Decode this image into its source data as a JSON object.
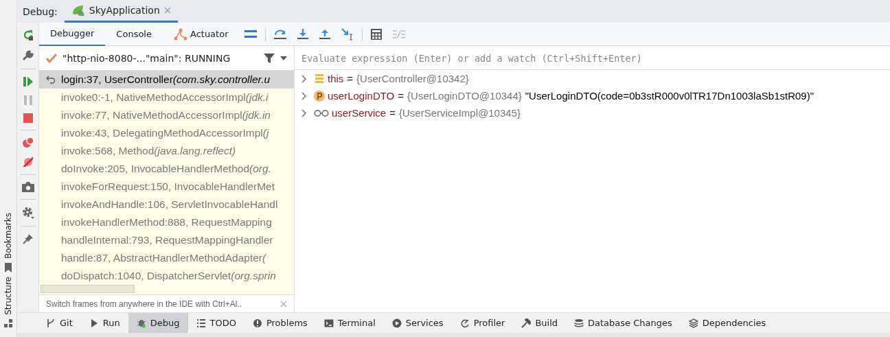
{
  "header": {
    "label": "Debug:",
    "tab": {
      "title": "SkyApplication",
      "selected": true
    }
  },
  "side_labels": [
    "Bookmarks",
    "Structure"
  ],
  "tabs": [
    {
      "label": "Debugger",
      "selected": true
    },
    {
      "label": "Console",
      "selected": false
    },
    {
      "label": "Actuator",
      "selected": false
    }
  ],
  "thread": {
    "text": "\"http-nio-8080-...\"main\": RUNNING"
  },
  "frames": [
    {
      "method": "login:37, UserController",
      "package": "(com.sky.controller.u",
      "kind": "user",
      "selected": true
    },
    {
      "method": "invoke0:-1, NativeMethodAccessorImpl",
      "package": "(jdk.i",
      "kind": "library",
      "selected": false
    },
    {
      "method": "invoke:77, NativeMethodAccessorImpl",
      "package": "(jdk.in",
      "kind": "library",
      "selected": false
    },
    {
      "method": "invoke:43, DelegatingMethodAccessorImpl",
      "package": "(j",
      "kind": "library",
      "selected": false
    },
    {
      "method": "invoke:568, Method",
      "package": "(java.lang.reflect)",
      "kind": "library",
      "selected": false
    },
    {
      "method": "doInvoke:205, InvocableHandlerMethod",
      "package": "(org.",
      "kind": "library",
      "selected": false
    },
    {
      "method": "invokeForRequest:150, InvocableHandlerMet",
      "kind": "library",
      "selected": false
    },
    {
      "method": "invokeAndHandle:106, ServletInvocableHandl",
      "kind": "library",
      "selected": false
    },
    {
      "method": "invokeHandlerMethod:888, RequestMapping",
      "kind": "library",
      "selected": false
    },
    {
      "method": "handleInternal:793, RequestMappingHandler",
      "kind": "library",
      "selected": false
    },
    {
      "method": "handle:87, AbstractHandlerMethodAdapter",
      "package": "(",
      "kind": "library",
      "selected": false
    },
    {
      "method": "doDispatch:1040, DispatcherServlet",
      "package": "(org.sprin",
      "kind": "library",
      "selected": false
    }
  ],
  "hint": "Switch frames from anywhere in the IDE with Ctrl+Al..",
  "evaluate": {
    "placeholder": "Evaluate expression (Enter) or add a watch (Ctrl+Shift+Enter)"
  },
  "variables": [
    {
      "kind": "field",
      "name": "this",
      "operator": "=",
      "ref": "{UserController@10342}"
    },
    {
      "kind": "parameter",
      "name": "userLoginDTO",
      "operator": "=",
      "ref": "{UserLoginDTO@10344}",
      "value": "\"UserLoginDTO(code=0b3stR000v0lTR17Dn1003laSb1stR09)\""
    },
    {
      "kind": "watch",
      "name": "userService",
      "operator": "=",
      "ref": "{UserServiceImpl@10345}"
    }
  ],
  "tool_windows": [
    {
      "label": "Git",
      "kind": "git",
      "selected": false
    },
    {
      "label": "Run",
      "kind": "run",
      "selected": false
    },
    {
      "label": "Debug",
      "kind": "debug",
      "selected": true
    },
    {
      "label": "TODO",
      "kind": "todo",
      "selected": false
    },
    {
      "label": "Problems",
      "kind": "problems",
      "selected": false
    },
    {
      "label": "Terminal",
      "kind": "terminal",
      "selected": false
    },
    {
      "label": "Services",
      "kind": "services",
      "selected": false
    },
    {
      "label": "Profiler",
      "kind": "profiler",
      "selected": false
    },
    {
      "label": "Build",
      "kind": "build",
      "selected": false
    },
    {
      "label": "Database Changes",
      "kind": "database",
      "selected": false
    },
    {
      "label": "Dependencies",
      "kind": "dependencies",
      "selected": false
    }
  ]
}
